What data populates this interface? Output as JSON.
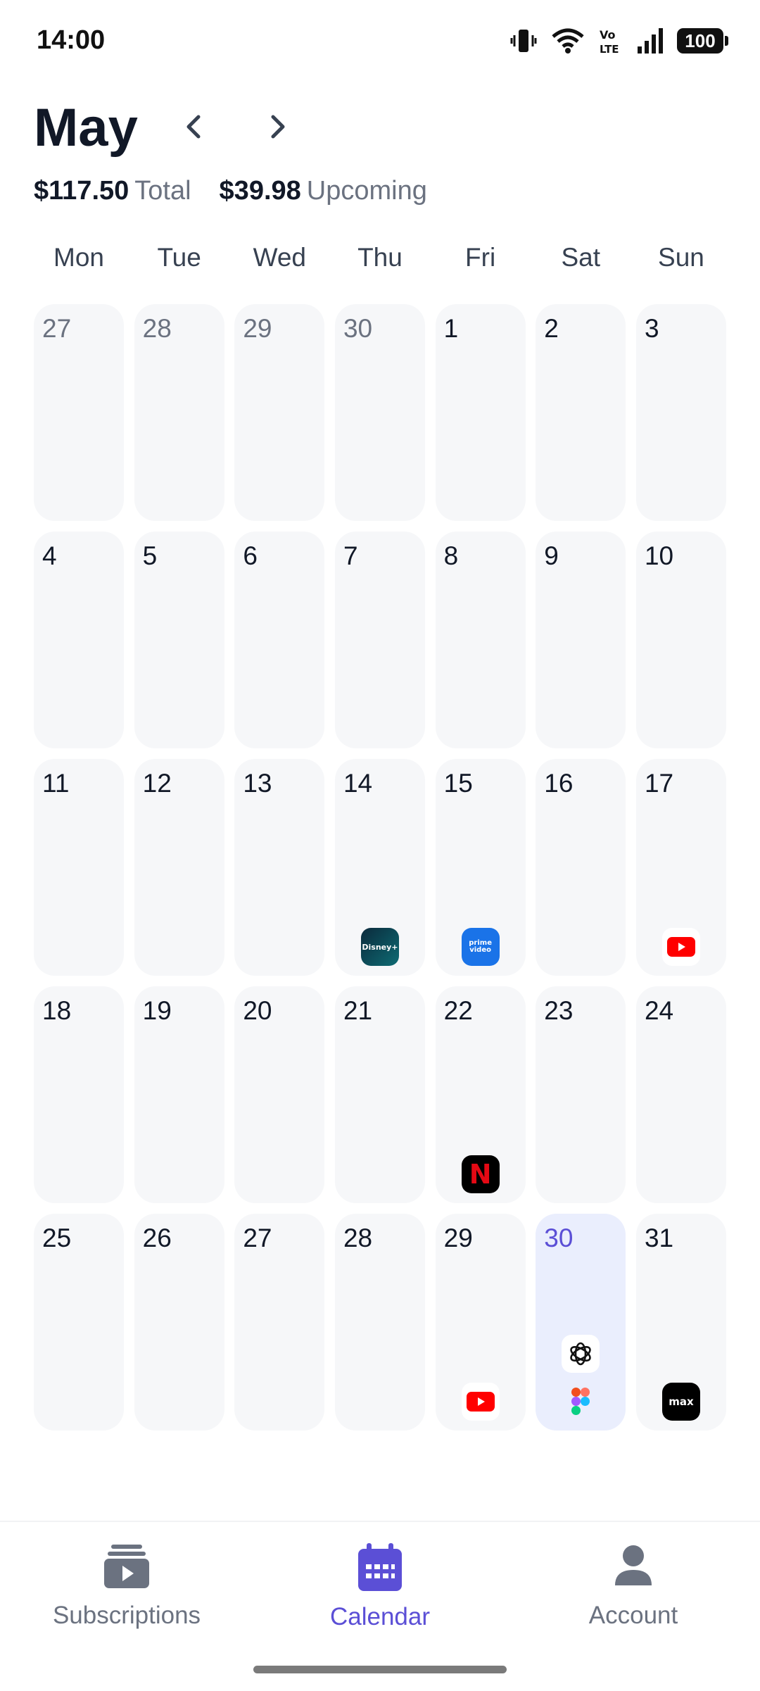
{
  "status_bar": {
    "time": "14:00",
    "battery": "100"
  },
  "header": {
    "month": "May",
    "total_amount": "$117.50",
    "total_label": "Total",
    "upcoming_amount": "$39.98",
    "upcoming_label": "Upcoming"
  },
  "weekdays": [
    "Mon",
    "Tue",
    "Wed",
    "Thu",
    "Fri",
    "Sat",
    "Sun"
  ],
  "weeks": [
    [
      {
        "day": "27",
        "muted": true
      },
      {
        "day": "28",
        "muted": true
      },
      {
        "day": "29",
        "muted": true
      },
      {
        "day": "30",
        "muted": true
      },
      {
        "day": "1"
      },
      {
        "day": "2"
      },
      {
        "day": "3"
      }
    ],
    [
      {
        "day": "4"
      },
      {
        "day": "5"
      },
      {
        "day": "6"
      },
      {
        "day": "7"
      },
      {
        "day": "8"
      },
      {
        "day": "9"
      },
      {
        "day": "10"
      }
    ],
    [
      {
        "day": "11"
      },
      {
        "day": "12"
      },
      {
        "day": "13"
      },
      {
        "day": "14",
        "subs": [
          "disney-plus-icon"
        ]
      },
      {
        "day": "15",
        "subs": [
          "prime-video-icon"
        ]
      },
      {
        "day": "16"
      },
      {
        "day": "17",
        "subs": [
          "youtube-icon"
        ]
      }
    ],
    [
      {
        "day": "18"
      },
      {
        "day": "19"
      },
      {
        "day": "20"
      },
      {
        "day": "21"
      },
      {
        "day": "22",
        "subs": [
          "netflix-icon"
        ]
      },
      {
        "day": "23"
      },
      {
        "day": "24"
      }
    ],
    [
      {
        "day": "25"
      },
      {
        "day": "26"
      },
      {
        "day": "27"
      },
      {
        "day": "28"
      },
      {
        "day": "29",
        "subs": [
          "youtube-icon"
        ]
      },
      {
        "day": "30",
        "today": true,
        "subs": [
          "openai-icon",
          "figma-icon"
        ]
      },
      {
        "day": "31",
        "subs": [
          "max-icon"
        ]
      }
    ]
  ],
  "bottom_nav": {
    "subscriptions": "Subscriptions",
    "calendar": "Calendar",
    "account": "Account"
  },
  "colors": {
    "accent": "#5B4FD6",
    "cell_bg": "#F6F7F9",
    "today_bg": "#EAEEFD",
    "muted_text": "#6B7280"
  }
}
